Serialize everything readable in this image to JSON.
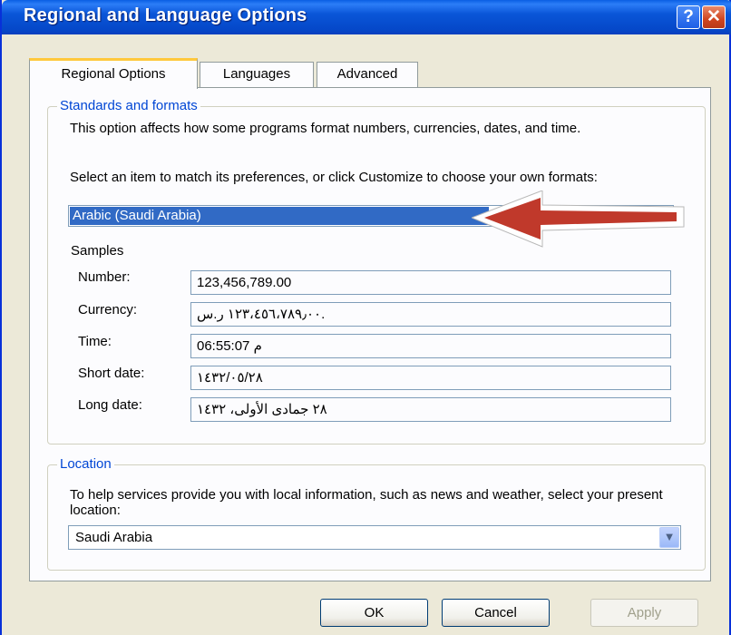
{
  "window": {
    "title": "Regional and Language Options",
    "help_glyph": "?",
    "close_glyph": "✕"
  },
  "tabs": [
    {
      "label": "Regional Options",
      "active": true
    },
    {
      "label": "Languages",
      "active": false
    },
    {
      "label": "Advanced",
      "active": false
    }
  ],
  "standards": {
    "legend": "Standards and formats",
    "description": "This option affects how some programs format numbers, currencies, dates, and time.",
    "select_prompt": "Select an item to match its preferences, or click Customize to choose your own formats:",
    "selected_format": "Arabic (Saudi Arabia)",
    "samples_label": "Samples",
    "samples": [
      {
        "label": "Number:",
        "value": "123,456,789.00"
      },
      {
        "label": "Currency:",
        "value": "١٢٣،٤٥٦،٧٨٩٫٠٠ ر.س."
      },
      {
        "label": "Time:",
        "value": "06:55:07 م"
      },
      {
        "label": "Short date:",
        "value": "١٤٣٢/٠٥/٢٨"
      },
      {
        "label": "Long date:",
        "value": "٢٨ جمادى الأولى، ١٤٣٢"
      }
    ]
  },
  "location": {
    "legend": "Location",
    "description": "To help services provide you with local information, such as news and weather, select your present location:",
    "selected": "Saudi Arabia"
  },
  "buttons": {
    "ok": "OK",
    "cancel": "Cancel",
    "apply": "Apply"
  },
  "colors": {
    "title_bar": "#0a56d8",
    "highlight": "#316ac5",
    "annotation_arrow": "#c0392b"
  }
}
